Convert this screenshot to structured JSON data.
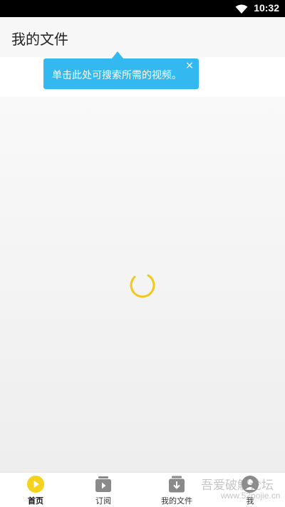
{
  "status_bar": {
    "time": "10:32",
    "wifi_icon": "wifi-icon"
  },
  "app_bar": {
    "title": "我的文件"
  },
  "tooltip": {
    "text": "单击此处可搜索所需的视频。",
    "close_label": "×",
    "color": "#33b9ef"
  },
  "content": {
    "loading_icon": "loading-spinner-icon",
    "spinner_color": "#f2c71f"
  },
  "bottom_nav": {
    "items": [
      {
        "label": "首页",
        "icon": "home-play-icon",
        "active": true
      },
      {
        "label": "订阅",
        "icon": "subscription-icon",
        "active": false
      },
      {
        "label": "我的文件",
        "icon": "download-files-icon",
        "active": false
      },
      {
        "label": "我",
        "icon": "profile-icon",
        "active": false
      }
    ]
  },
  "watermark": {
    "line1": "吾爱破解论坛",
    "line2": "www.52pojie.cn"
  }
}
